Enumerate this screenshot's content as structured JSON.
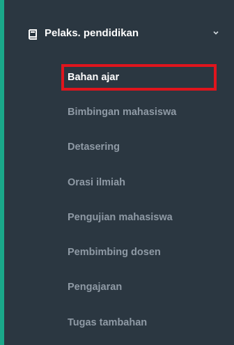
{
  "sidebar": {
    "accent_color": "#1aa88a",
    "background_color": "#2b3741",
    "group": {
      "label": "Pelaks. pendidikan",
      "icon": "book-icon",
      "expanded": true
    },
    "items": [
      {
        "label": "Bahan ajar",
        "active": true
      },
      {
        "label": "Bimbingan mahasiswa",
        "active": false
      },
      {
        "label": "Detasering",
        "active": false
      },
      {
        "label": "Orasi ilmiah",
        "active": false
      },
      {
        "label": "Pengujian mahasiswa",
        "active": false
      },
      {
        "label": "Pembimbing dosen",
        "active": false
      },
      {
        "label": "Pengajaran",
        "active": false
      },
      {
        "label": "Tugas tambahan",
        "active": false
      }
    ],
    "highlight_color": "#e0151d"
  }
}
